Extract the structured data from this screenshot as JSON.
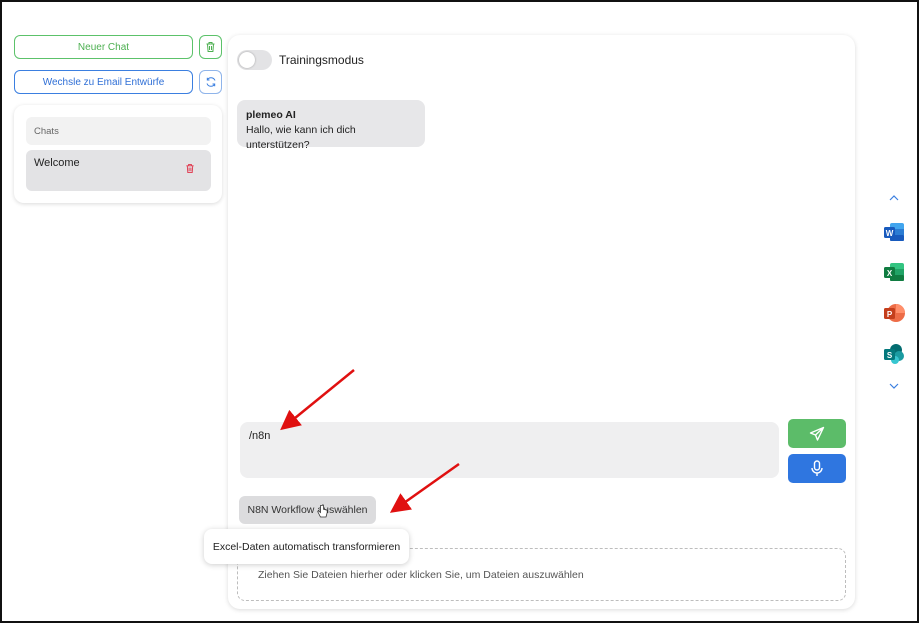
{
  "sidebar": {
    "new_chat_label": "Neuer Chat",
    "switch_label": "Wechsle zu Email Entwürfe",
    "chats_header": "Chats",
    "chats": [
      {
        "title": "Welcome"
      }
    ]
  },
  "main": {
    "training_mode_label": "Trainingsmodus",
    "training_mode_on": false,
    "message": {
      "sender": "plemeo AI",
      "text": "Hallo, wie kann ich dich unterstützen?"
    },
    "input_value": "/n8n",
    "workflow_button_label": "N8N Workflow auswählen",
    "tooltip_text": "Excel-Daten automatisch transformieren",
    "dropzone_text": "Ziehen Sie Dateien hierher oder klicken Sie, um Dateien auszuwählen"
  },
  "rail": {
    "apps": [
      "word-icon",
      "excel-icon",
      "powerpoint-icon",
      "sharepoint-icon"
    ]
  },
  "colors": {
    "green": "#5cbc69",
    "blue": "#2f76e0",
    "annotation_red": "#e01010"
  }
}
